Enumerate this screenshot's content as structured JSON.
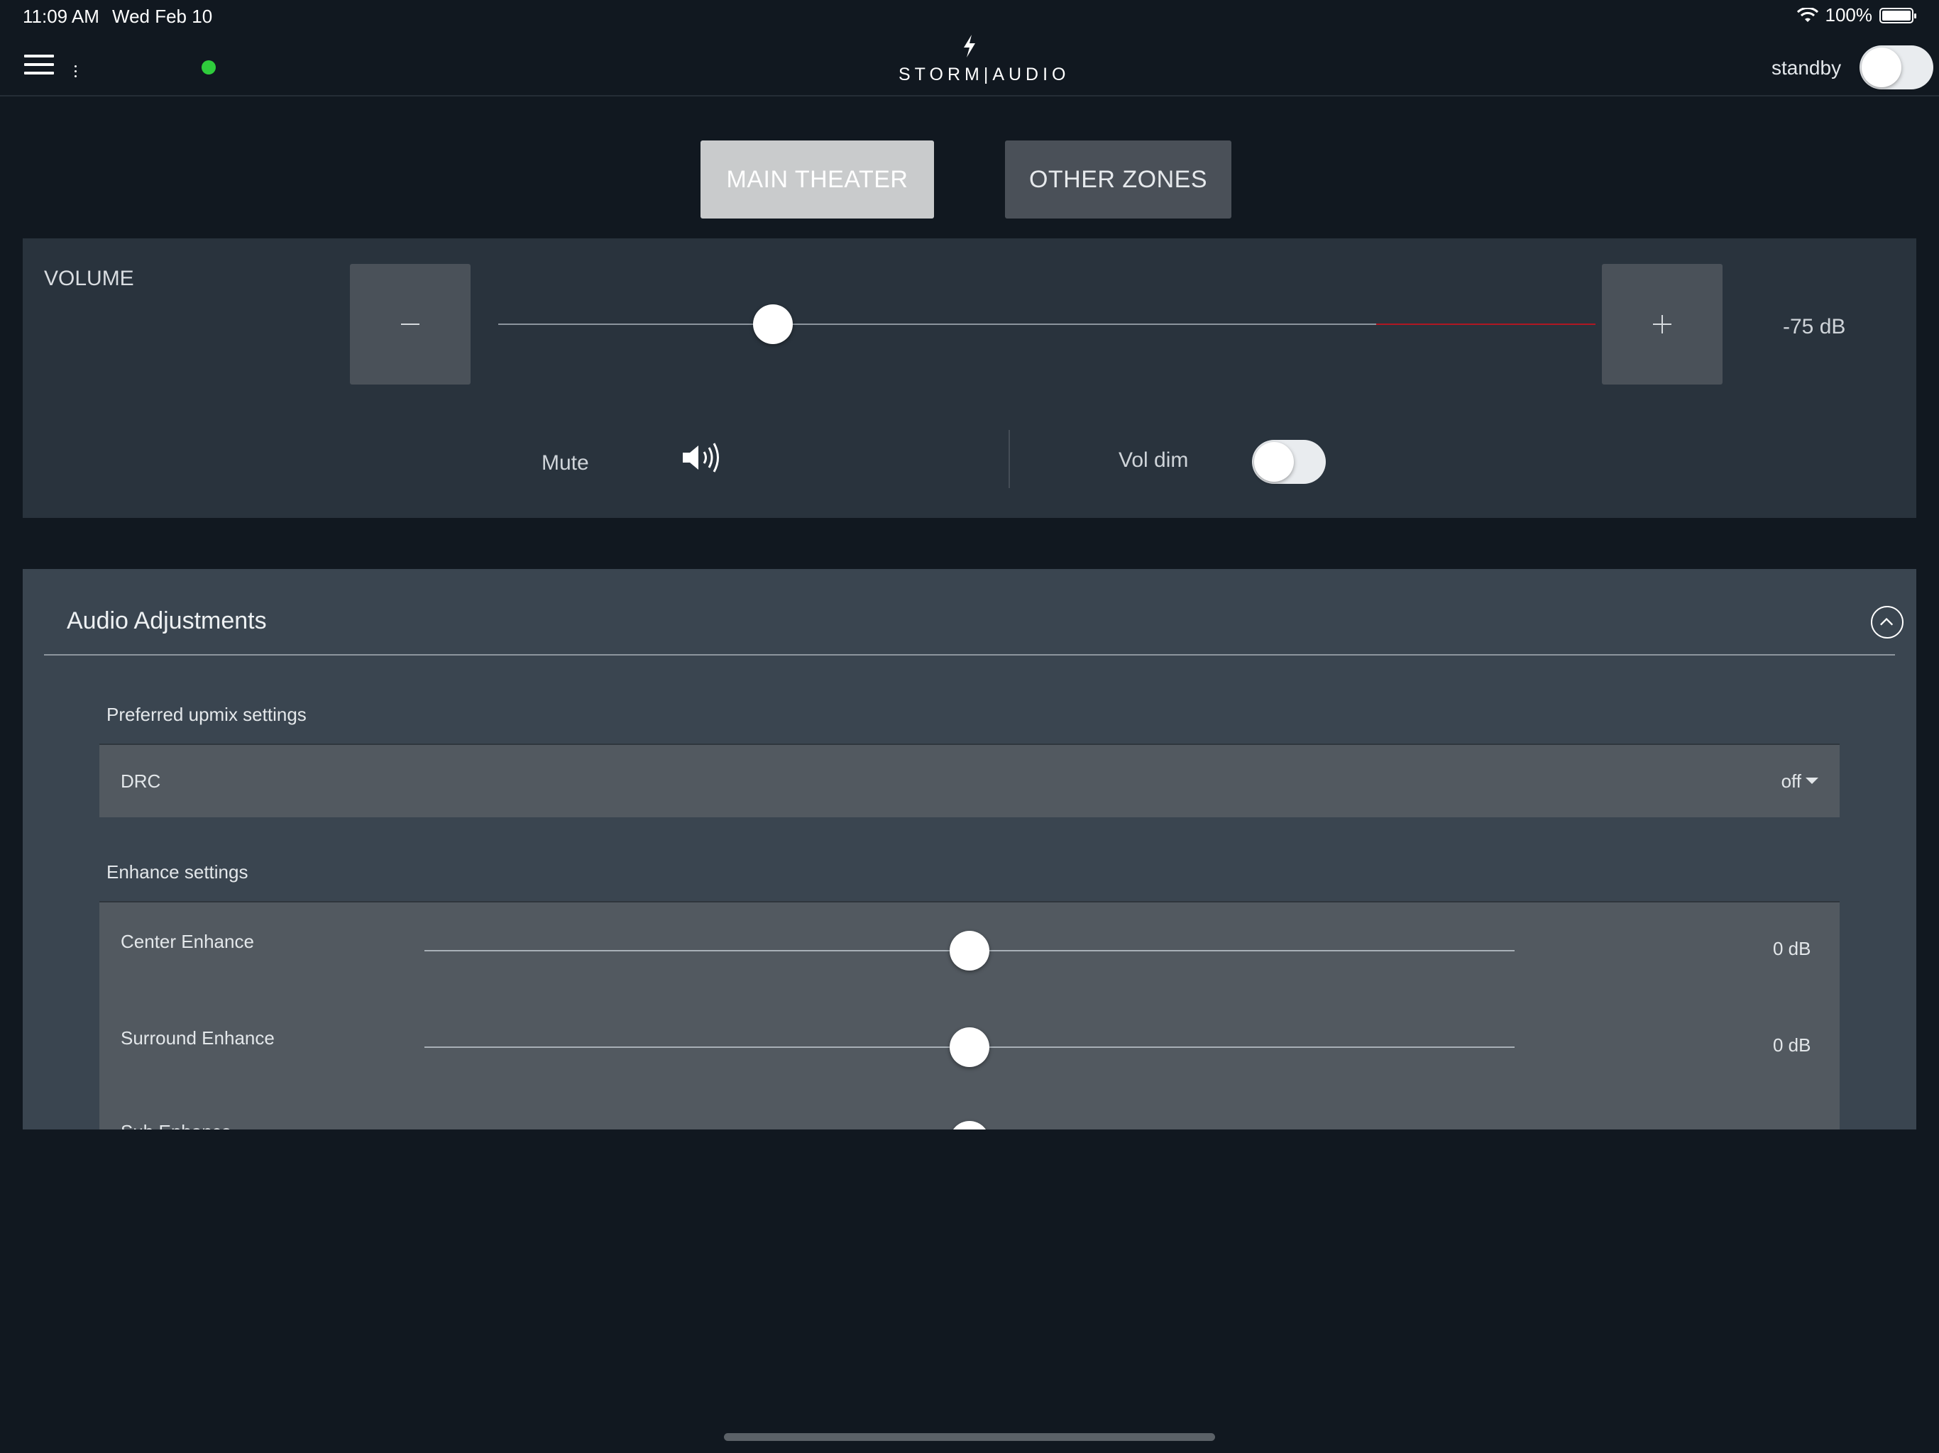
{
  "statusbar": {
    "time": "11:09 AM",
    "date": "Wed Feb 10",
    "battery": "100%"
  },
  "header": {
    "brand": "STORM|AUDIO",
    "standby_label": "standby",
    "standby_on": false,
    "connected_color": "#2fcc3c"
  },
  "tabs": [
    {
      "label": "MAIN THEATER",
      "active": true
    },
    {
      "label": "OTHER ZONES",
      "active": false
    }
  ],
  "volume": {
    "label": "VOLUME",
    "value": "-75 dB",
    "slider_fraction": 0.25,
    "red_zone_from": 0.8,
    "mute_label": "Mute",
    "voldim_label": "Vol dim",
    "voldim_on": false
  },
  "audio_adjustments": {
    "title": "Audio Adjustments",
    "upmix_section": "Preferred upmix settings",
    "drc": {
      "label": "DRC",
      "value": "off"
    },
    "enhance_section": "Enhance settings",
    "enhance": [
      {
        "label": "Center Enhance",
        "value": "0 dB",
        "fraction": 0.5
      },
      {
        "label": "Surround Enhance",
        "value": "0 dB",
        "fraction": 0.5
      },
      {
        "label": "Sub Enhance",
        "value": "",
        "fraction": 0.5
      }
    ]
  }
}
